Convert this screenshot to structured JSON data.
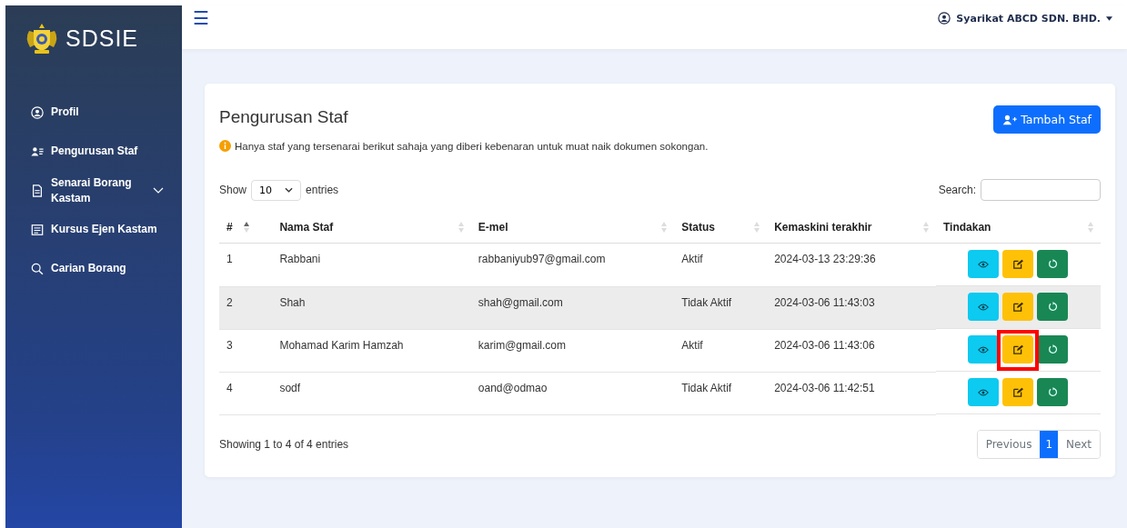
{
  "sidebar": {
    "brand": "SDSIE",
    "items": [
      {
        "label": "Profil",
        "expandable": false
      },
      {
        "label": "Pengurusan Staf",
        "expandable": false
      },
      {
        "label": "Senarai Borang Kastam",
        "expandable": true
      },
      {
        "label": "Kursus Ejen Kastam",
        "expandable": false
      },
      {
        "label": "Carian Borang",
        "expandable": false
      }
    ]
  },
  "topbar": {
    "menu_icon": "☰",
    "user": "Syarikat ABCD SDN. BHD."
  },
  "card": {
    "title": "Pengurusan Staf",
    "notice": "Hanya staf yang tersenarai berikut sahaja yang diberi kebenaran untuk muat naik dokumen sokongan.",
    "add_button": "Tambah Staf",
    "length": {
      "before": "Show",
      "value": "10",
      "after": "entries"
    },
    "search": {
      "label": "Search:"
    },
    "table": {
      "columns": [
        {
          "label": "#",
          "sorted": true
        },
        {
          "label": "Nama Staf",
          "sorted": false
        },
        {
          "label": "E-mel",
          "sorted": false
        },
        {
          "label": "Status",
          "sorted": false
        },
        {
          "label": "Kemaskini terakhir",
          "sorted": false
        },
        {
          "label": "Tindakan",
          "sorted": false
        }
      ],
      "rows": [
        {
          "cells": [
            "1",
            "Rabbani",
            "rabbaniyub97@gmail.com",
            "Aktif",
            "2024-03-13 23:29:36"
          ],
          "hovered": false,
          "edit_highlighted": false
        },
        {
          "cells": [
            "2",
            "Shah",
            "shah@gmail.com",
            "Tidak Aktif",
            "2024-03-06 11:43:03"
          ],
          "hovered": true,
          "edit_highlighted": false
        },
        {
          "cells": [
            "3",
            "Mohamad Karim Hamzah",
            "karim@gmail.com",
            "Aktif",
            "2024-03-06 11:43:06"
          ],
          "hovered": false,
          "edit_highlighted": true
        },
        {
          "cells": [
            "4",
            "sodf",
            "oand@odmao",
            "Tidak Aktif",
            "2024-03-06 11:42:51"
          ],
          "hovered": false,
          "edit_highlighted": false
        }
      ]
    },
    "info": "Showing 1 to 4 of 4 entries",
    "pagination": [
      {
        "label": "Previous",
        "selected": false
      },
      {
        "label": "1",
        "selected": true
      },
      {
        "label": "Next",
        "selected": false
      }
    ]
  }
}
